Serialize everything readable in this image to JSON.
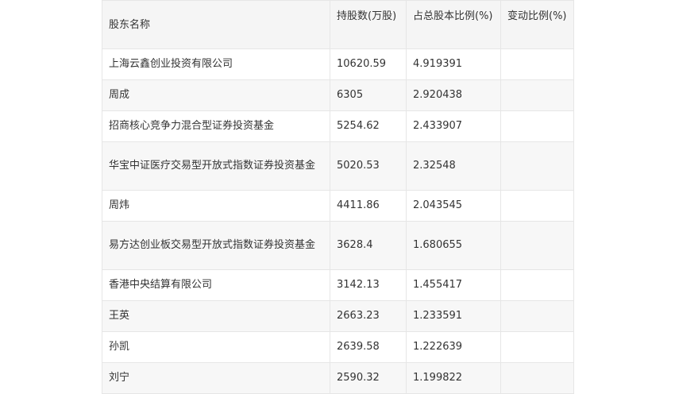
{
  "table": {
    "headers": [
      "股东名称",
      "持股数(万股)",
      "占总股本比例(%)",
      "变动比例(%)"
    ],
    "rows": [
      [
        "上海云鑫创业投资有限公司",
        "10620.59",
        "4.919391",
        ""
      ],
      [
        "周成",
        "6305",
        "2.920438",
        ""
      ],
      [
        "招商核心竞争力混合型证券投资基金",
        "5254.62",
        "2.433907",
        ""
      ],
      [
        "华宝中证医疗交易型开放式指数证券投资基金",
        "5020.53",
        "2.32548",
        ""
      ],
      [
        "周炜",
        "4411.86",
        "2.043545",
        ""
      ],
      [
        "易方达创业板交易型开放式指数证券投资基金",
        "3628.4",
        "1.680655",
        ""
      ],
      [
        "香港中央结算有限公司",
        "3142.13",
        "1.455417",
        ""
      ],
      [
        "王英",
        "2663.23",
        "1.233591",
        ""
      ],
      [
        "孙凯",
        "2639.58",
        "1.222639",
        ""
      ],
      [
        "刘宁",
        "2590.32",
        "1.199822",
        ""
      ]
    ]
  }
}
